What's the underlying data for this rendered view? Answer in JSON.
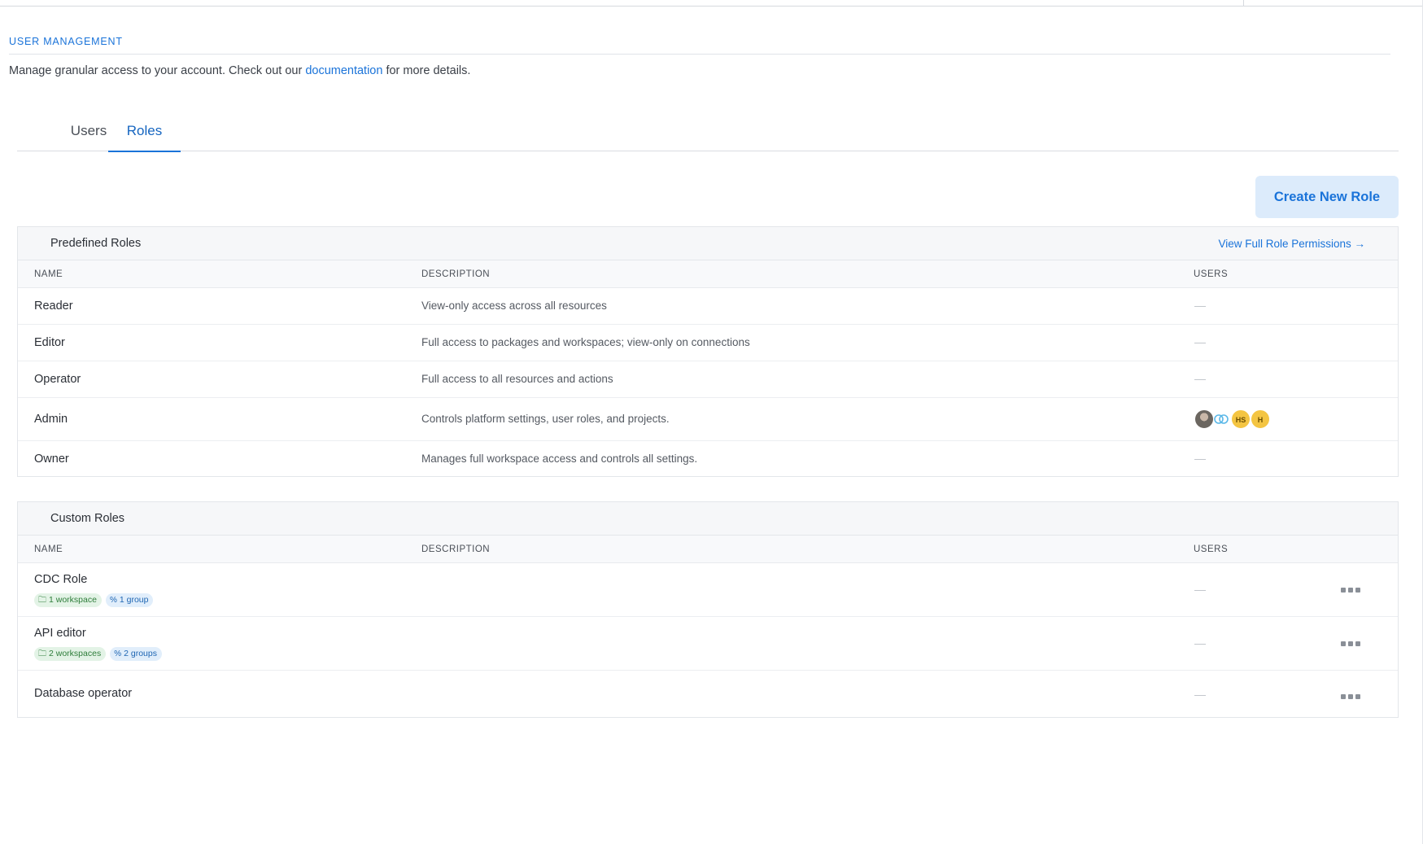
{
  "header": {
    "section_title": "USER MANAGEMENT",
    "intro_prefix": "Manage granular access to your account. Check out our ",
    "intro_link": "documentation",
    "intro_suffix": " for more details."
  },
  "tabs": [
    {
      "label": "Users",
      "active": false
    },
    {
      "label": "Roles",
      "active": true
    }
  ],
  "actions": {
    "create_role_label": "Create New Role"
  },
  "predefined": {
    "title": "Predefined Roles",
    "view_link": "View Full Role Permissions →",
    "columns": {
      "name": "NAME",
      "description": "DESCRIPTION",
      "users": "USERS"
    },
    "rows": [
      {
        "name": "Reader",
        "description": "View-only access across all resources"
      },
      {
        "name": "Editor",
        "description": "Full access to packages and workspaces; view-only on connections"
      },
      {
        "name": "Operator",
        "description": "Full access to all resources and actions"
      },
      {
        "name": "Admin",
        "description": "Controls platform settings, user roles, and projects.",
        "avatars": [
          "HS",
          "H"
        ]
      },
      {
        "name": "Owner",
        "description": "Manages full workspace access and controls all settings."
      }
    ]
  },
  "custom": {
    "title": "Custom Roles",
    "columns": {
      "name": "NAME",
      "description": "DESCRIPTION",
      "users": "USERS"
    },
    "rows": [
      {
        "name": "CDC Role",
        "workspaces": "1 workspace",
        "groups": "1 group"
      },
      {
        "name": "API editor",
        "workspaces": "2 workspaces",
        "groups": "2 groups"
      },
      {
        "name": "Database operator"
      }
    ]
  },
  "colors": {
    "accent": "#1a73d9",
    "button_bg": "#dcebfb",
    "avatar_yellow": "#f4c542"
  },
  "icons": [
    "folder-icon",
    "link-icon",
    "more-icon",
    "arrow-right-icon"
  ]
}
